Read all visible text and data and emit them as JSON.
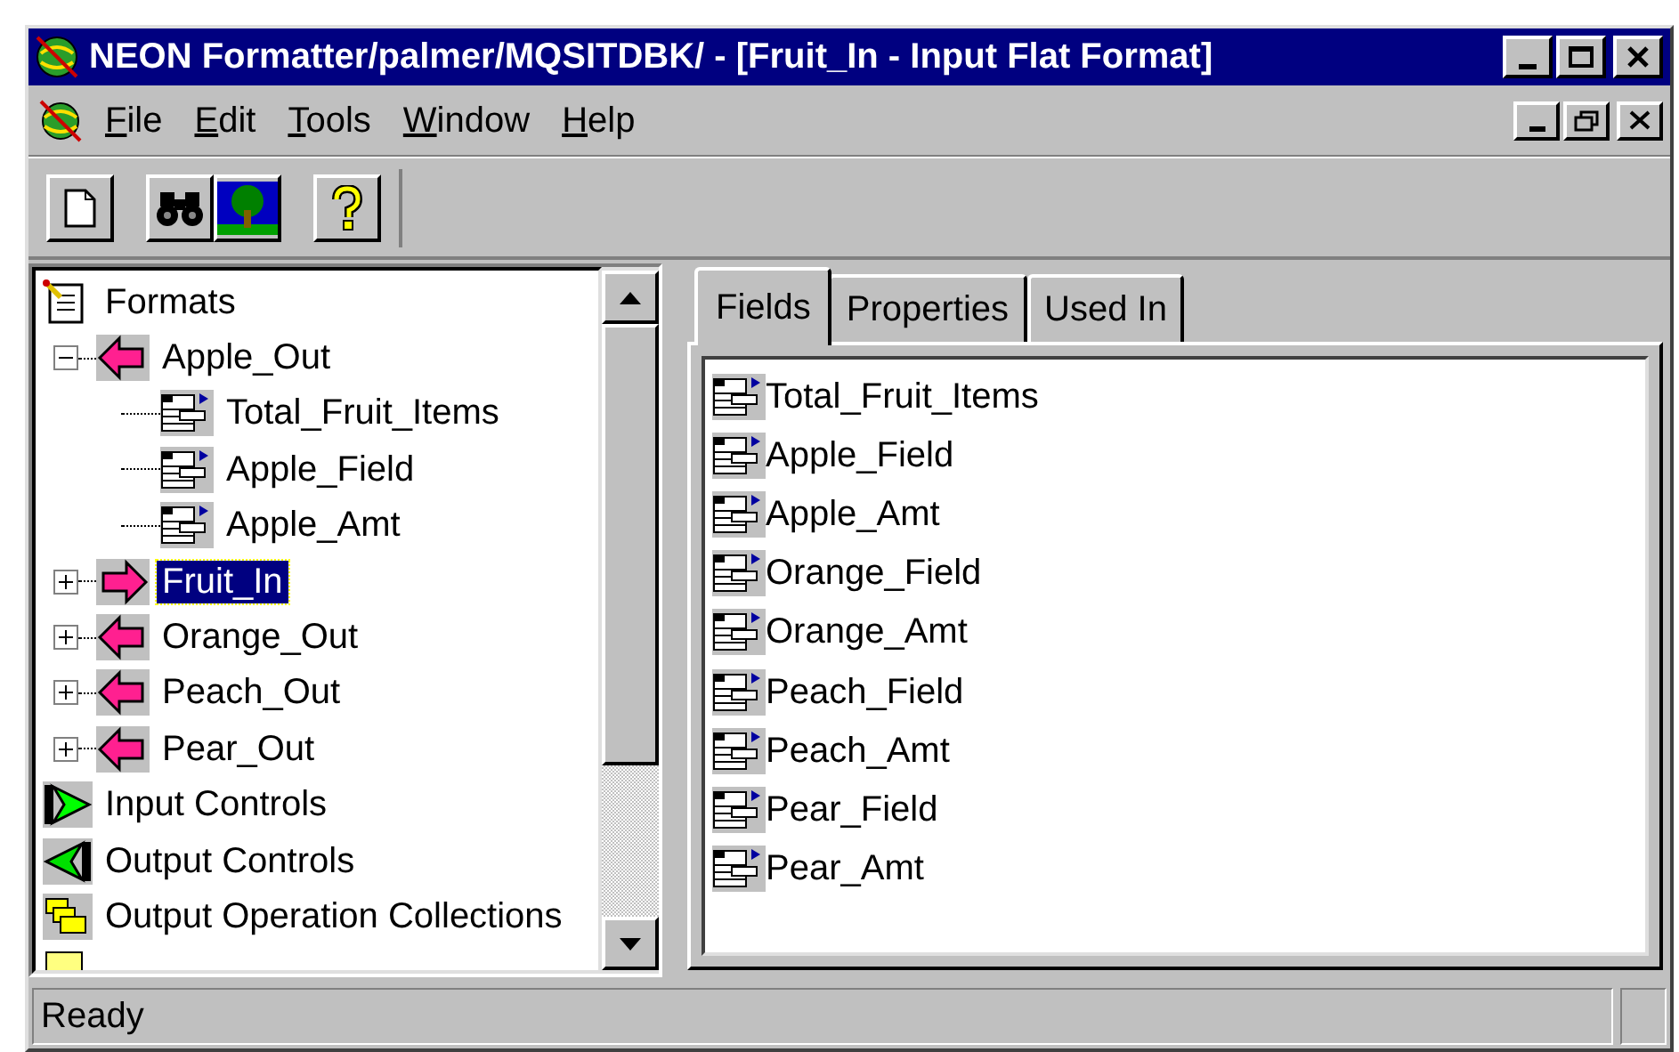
{
  "window": {
    "title": "NEON Formatter/palmer/MQSITDBK/ - [Fruit_In - Input Flat Format]"
  },
  "menu": [
    {
      "label": "File"
    },
    {
      "label": "Edit"
    },
    {
      "label": "Tools"
    },
    {
      "label": "Window"
    },
    {
      "label": "Help"
    }
  ],
  "toolbar": [
    {
      "kind": "new"
    },
    {
      "kind": "find"
    },
    {
      "kind": "tree"
    },
    {
      "kind": "help"
    }
  ],
  "tree": [
    {
      "label": "Formats",
      "kind": "formats",
      "selected": false,
      "children": [
        {
          "label": "Apple_Out",
          "kind": "output",
          "expanded": true,
          "selected": false,
          "children": [
            {
              "label": "Total_Fruit_Items",
              "kind": "field",
              "selected": false
            },
            {
              "label": "Apple_Field",
              "kind": "field",
              "selected": false
            },
            {
              "label": "Apple_Amt",
              "kind": "field",
              "selected": false
            }
          ]
        },
        {
          "label": "Fruit_In",
          "kind": "input",
          "expanded": false,
          "selected": true
        },
        {
          "label": "Orange_Out",
          "kind": "output",
          "expanded": false,
          "selected": false
        },
        {
          "label": "Peach_Out",
          "kind": "output",
          "expanded": false,
          "selected": false
        },
        {
          "label": "Pear_Out",
          "kind": "output",
          "expanded": false,
          "selected": false
        }
      ]
    },
    {
      "label": "Input Controls",
      "kind": "input-controls",
      "selected": false
    },
    {
      "label": "Output Controls",
      "kind": "output-controls",
      "selected": false
    },
    {
      "label": "Output Operation Collections",
      "kind": "collections",
      "selected": false
    }
  ],
  "tabs": [
    {
      "label": "Fields",
      "selected": true
    },
    {
      "label": "Properties",
      "selected": false
    },
    {
      "label": "Used In",
      "selected": false
    }
  ],
  "fields": [
    "Total_Fruit_Items",
    "Apple_Field",
    "Apple_Amt",
    "Orange_Field",
    "Orange_Amt",
    "Peach_Field",
    "Peach_Amt",
    "Pear_Field",
    "Pear_Amt"
  ],
  "status_bar": {
    "text": "Ready"
  }
}
